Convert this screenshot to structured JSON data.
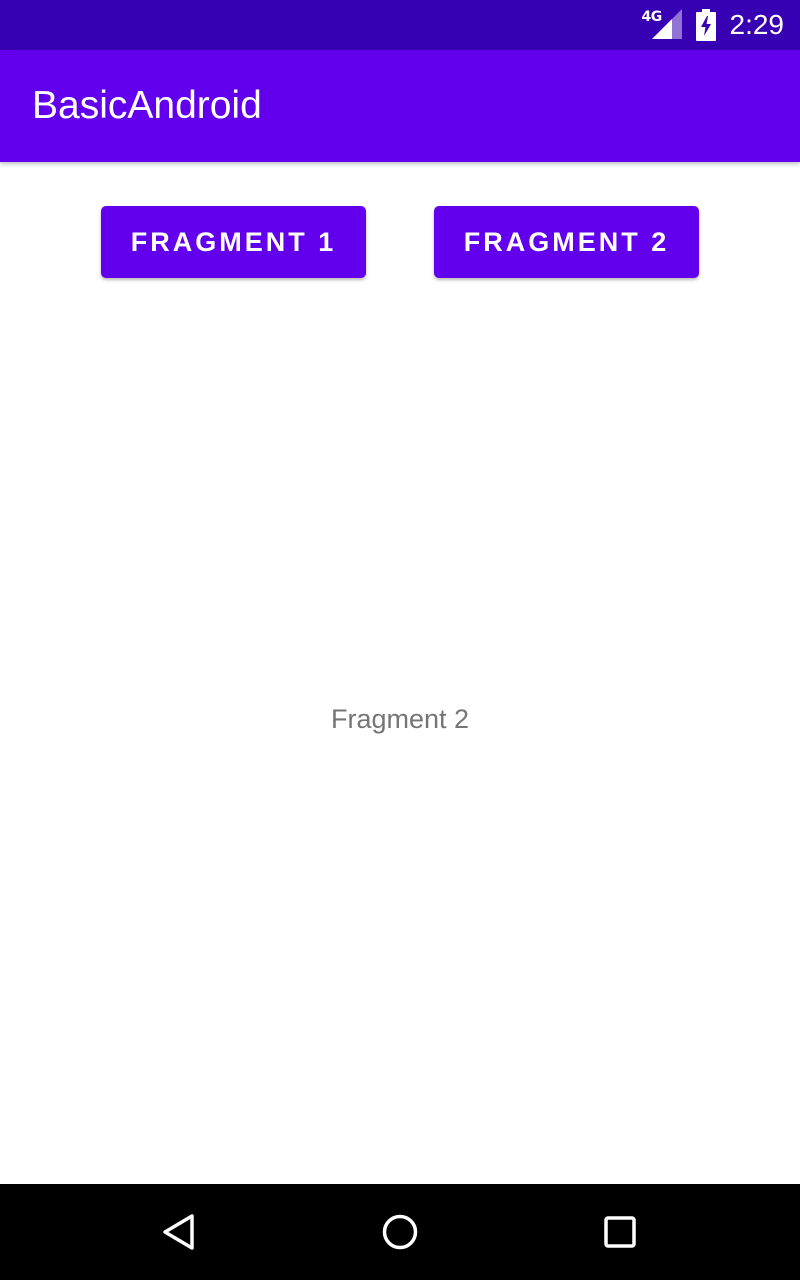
{
  "colors": {
    "status_bar": "#3700B3",
    "primary": "#6200EE",
    "on_primary": "#FFFFFF",
    "body_text": "#757575",
    "nav_bar": "#000000"
  },
  "status_bar": {
    "network_label": "4G",
    "time": "2:29",
    "icons": [
      "signal-icon",
      "battery-charging-icon"
    ]
  },
  "app_bar": {
    "title": "BasicAndroid"
  },
  "buttons": [
    {
      "label": "FRAGMENT 1"
    },
    {
      "label": "FRAGMENT 2"
    }
  ],
  "content": {
    "text": "Fragment 2"
  },
  "nav_bar": {
    "icons": [
      "back-icon",
      "home-icon",
      "recents-icon"
    ]
  }
}
